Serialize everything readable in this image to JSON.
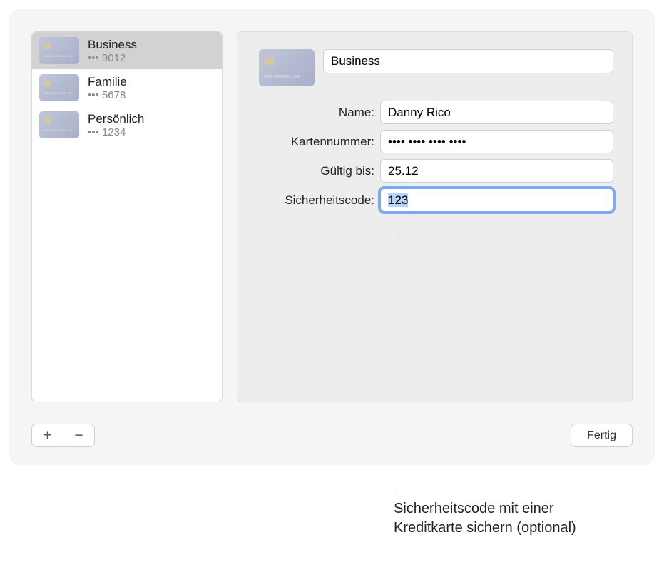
{
  "sidebar": {
    "items": [
      {
        "title": "Business",
        "sub": "••• 9012",
        "selected": true
      },
      {
        "title": "Familie",
        "sub": "••• 5678",
        "selected": false
      },
      {
        "title": "Persönlich",
        "sub": "••• 1234",
        "selected": false
      }
    ]
  },
  "detail": {
    "title_value": "Business",
    "fields": {
      "name": {
        "label": "Name:",
        "value": "Danny Rico"
      },
      "number": {
        "label": "Kartennummer:",
        "value": "•••• •••• •••• ••••"
      },
      "expires": {
        "label": "Gültig bis:",
        "value": "25.12"
      },
      "security": {
        "label": "Sicherheitscode:",
        "value": "123"
      }
    }
  },
  "buttons": {
    "add": "+",
    "remove": "−",
    "done": "Fertig"
  },
  "callout": "Sicherheitscode mit einer Kreditkarte sichern (optional)"
}
